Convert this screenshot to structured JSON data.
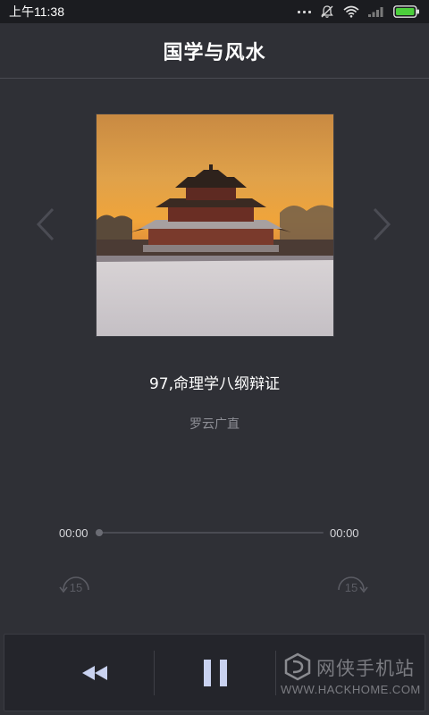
{
  "status_bar": {
    "time": "上午11:38"
  },
  "header": {
    "title": "国学与风水"
  },
  "cover": {
    "icon_prev": "chevron-left-icon",
    "icon_next": "chevron-right-icon"
  },
  "track": {
    "title": "97,命理学八纲辩证",
    "artist": "罗云广直"
  },
  "progress": {
    "current_time": "00:00",
    "total_time": "00:00",
    "fraction": 0
  },
  "skip": {
    "back_seconds": "15",
    "forward_seconds": "15"
  },
  "controls": {
    "rewind_icon": "rewind-icon",
    "pause_icon": "pause-icon"
  },
  "watermark": {
    "brand": "网侠手机站",
    "url": "WWW.HACKHOME.COM"
  },
  "colors": {
    "background": "#2f3036",
    "status_bar": "#1b1c20",
    "bottom_bar": "#24252b",
    "accent_button": "#c9d2f0"
  }
}
